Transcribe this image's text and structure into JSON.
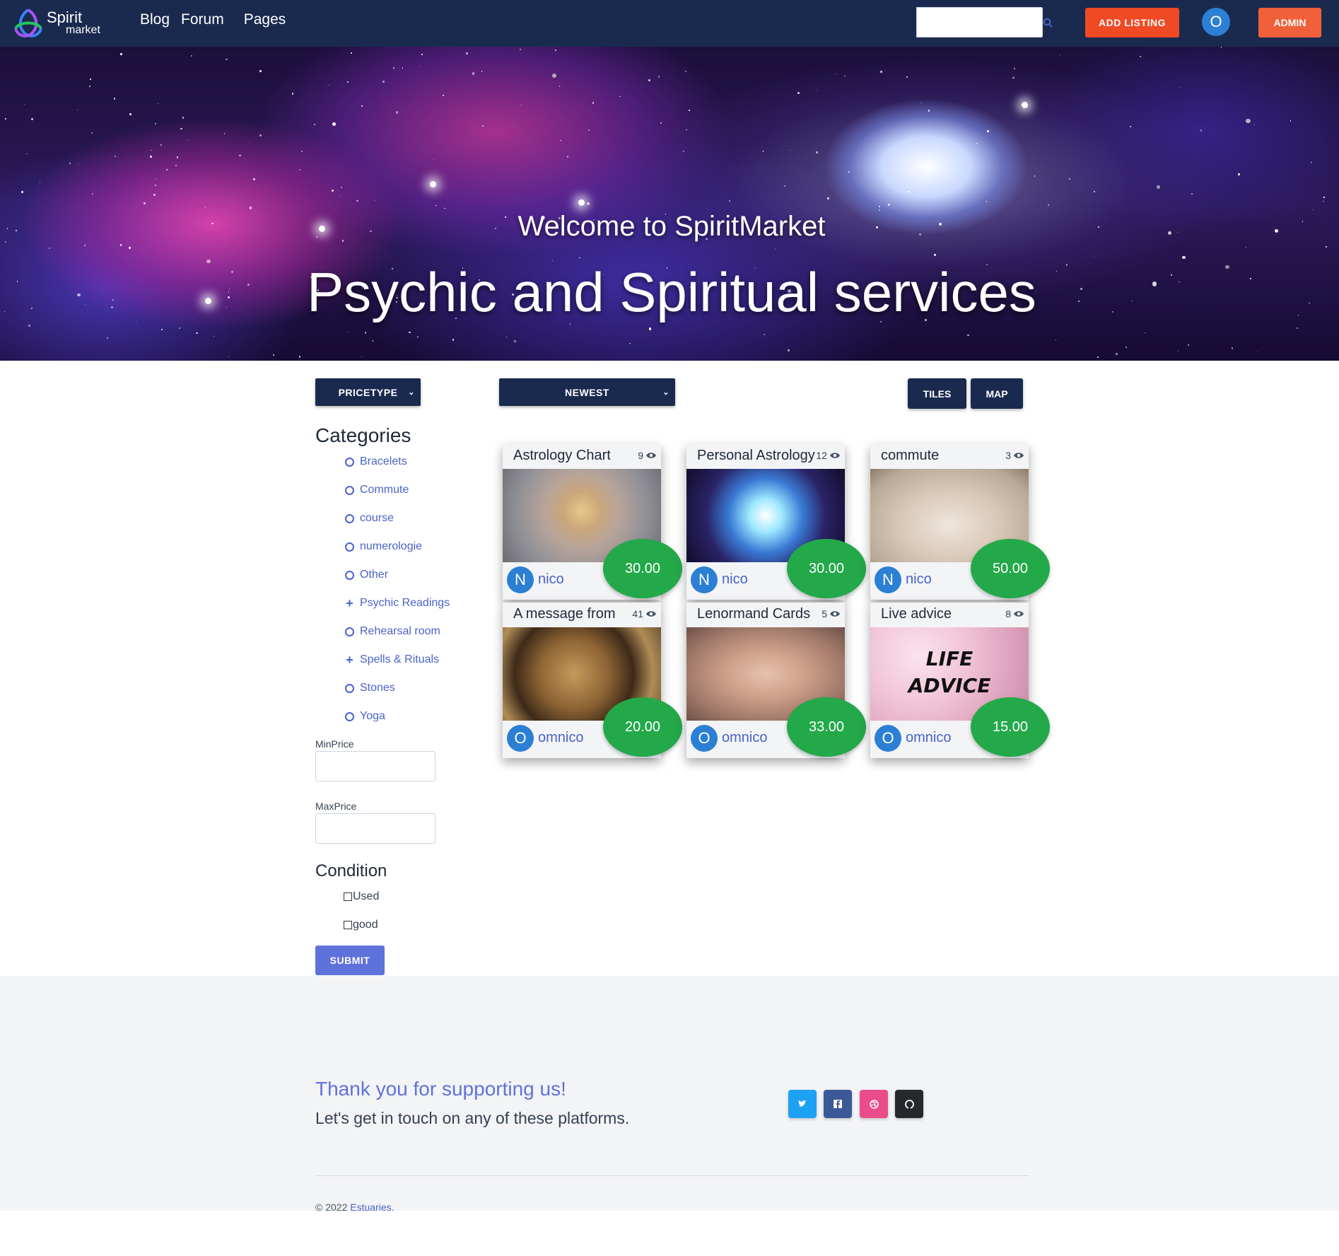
{
  "nav": {
    "logo_line1": "Spirit",
    "logo_line2": "market",
    "links": [
      "Blog",
      "Forum",
      "Pages"
    ],
    "search_placeholder": "",
    "add_listing": "ADD LISTING",
    "user_initial": "O",
    "admin": "ADMIN"
  },
  "hero": {
    "subtitle": "Welcome to SpiritMarket",
    "title": "Psychic and Spiritual services"
  },
  "filters": {
    "pricetype": "PRICETYPE",
    "sort": "NEWEST",
    "tiles": "TILES",
    "map": "MAP"
  },
  "sidebar": {
    "categories_title": "Categories",
    "categories": [
      {
        "label": "Bracelets",
        "icon": "circle"
      },
      {
        "label": "Commute",
        "icon": "circle"
      },
      {
        "label": "course",
        "icon": "circle"
      },
      {
        "label": "numerologie",
        "icon": "circle"
      },
      {
        "label": "Other",
        "icon": "circle"
      },
      {
        "label": "Psychic Readings",
        "icon": "plus"
      },
      {
        "label": "Rehearsal room",
        "icon": "circle"
      },
      {
        "label": "Spells & Rituals",
        "icon": "plus"
      },
      {
        "label": "Stones",
        "icon": "circle"
      },
      {
        "label": "Yoga",
        "icon": "circle"
      }
    ],
    "min_price_label": "MinPrice",
    "max_price_label": "MaxPrice",
    "condition_title": "Condition",
    "conditions": [
      "Used",
      "good"
    ],
    "submit": "SUBMIT"
  },
  "listings": [
    {
      "title": "Astrology Chart",
      "views": "9",
      "user_initial": "N",
      "user": "nico",
      "price": "30.00"
    },
    {
      "title": "Personal Astrology",
      "views": "12",
      "user_initial": "N",
      "user": "nico",
      "price": "30.00"
    },
    {
      "title": "commute",
      "views": "3",
      "user_initial": "N",
      "user": "nico",
      "price": "50.00"
    },
    {
      "title": "A message from",
      "views": "41",
      "user_initial": "O",
      "user": "omnico",
      "price": "20.00"
    },
    {
      "title": "Lenormand Cards",
      "views": "5",
      "user_initial": "O",
      "user": "omnico",
      "price": "33.00"
    },
    {
      "title": "Live advice",
      "views": "8",
      "user_initial": "O",
      "user": "omnico",
      "price": "15.00",
      "image_text": [
        "LIFE",
        "ADVICE"
      ]
    }
  ],
  "footer": {
    "heading": "Thank you for supporting us!",
    "text": "Let's get in touch on any of these platforms.",
    "copyright": "© 2022 ",
    "company": "Estuaries."
  },
  "colors": {
    "nav_bg": "#1a2a4f",
    "accent_orange": "#f04a24",
    "price_green": "#23a94a",
    "link_blue": "#4a63c8",
    "submit_blue": "#5f72dc"
  }
}
